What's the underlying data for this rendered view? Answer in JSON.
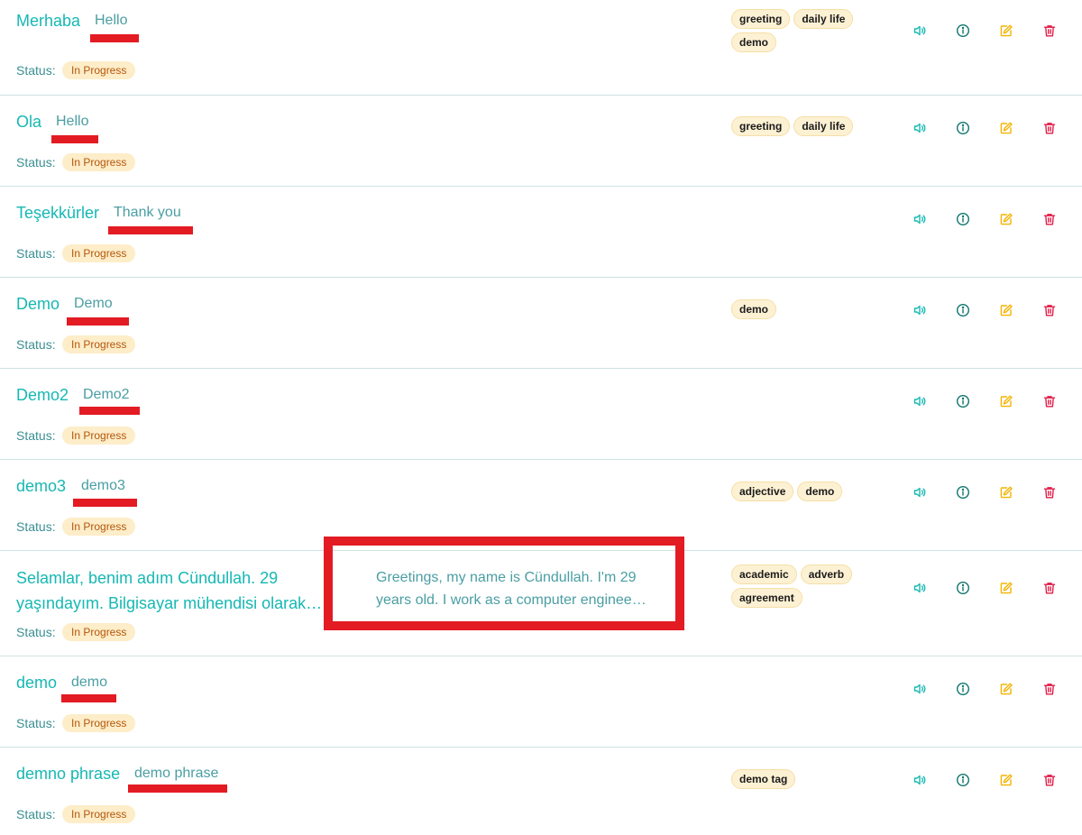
{
  "status_label": "Status:",
  "items": [
    {
      "word": "Merhaba",
      "translation": "Hello",
      "status": "In Progress",
      "tags": [
        "greeting",
        "daily life",
        "demo"
      ]
    },
    {
      "word": "Ola",
      "translation": "Hello",
      "status": "In Progress",
      "tags": [
        "greeting",
        "daily life"
      ]
    },
    {
      "word": "Teşekkürler",
      "translation": "Thank you",
      "status": "In Progress",
      "tags": []
    },
    {
      "word": "Demo",
      "translation": "Demo",
      "status": "In Progress",
      "tags": [
        "demo"
      ]
    },
    {
      "word": "Demo2",
      "translation": "Demo2",
      "status": "In Progress",
      "tags": []
    },
    {
      "word": "demo3",
      "translation": "demo3",
      "status": "In Progress",
      "tags": [
        "adjective",
        "demo"
      ]
    },
    {
      "word": "Selamlar, benim adım Cündullah. 29 yaşındayım. Bilgisayar mühendisi olarak…",
      "translation": "Greetings, my name is Cündullah. I'm 29 years old. I work as a computer enginee…",
      "status": "In Progress",
      "tags": [
        "academic",
        "adverb",
        "agreement"
      ]
    },
    {
      "word": "demo",
      "translation": "demo",
      "status": "In Progress",
      "tags": []
    },
    {
      "word": "demno phrase",
      "translation": "demo phrase",
      "status": "In Progress",
      "tags": [
        "demo tag"
      ]
    }
  ],
  "colors": {
    "accent": "#16b8b3",
    "info": "#0f766e",
    "edit": "#f4b400",
    "delete": "#e11d48",
    "annotation": "#e31b23"
  },
  "icons": {
    "speak": "speaker-icon",
    "info": "info-icon",
    "edit": "edit-icon",
    "delete": "trash-icon"
  }
}
